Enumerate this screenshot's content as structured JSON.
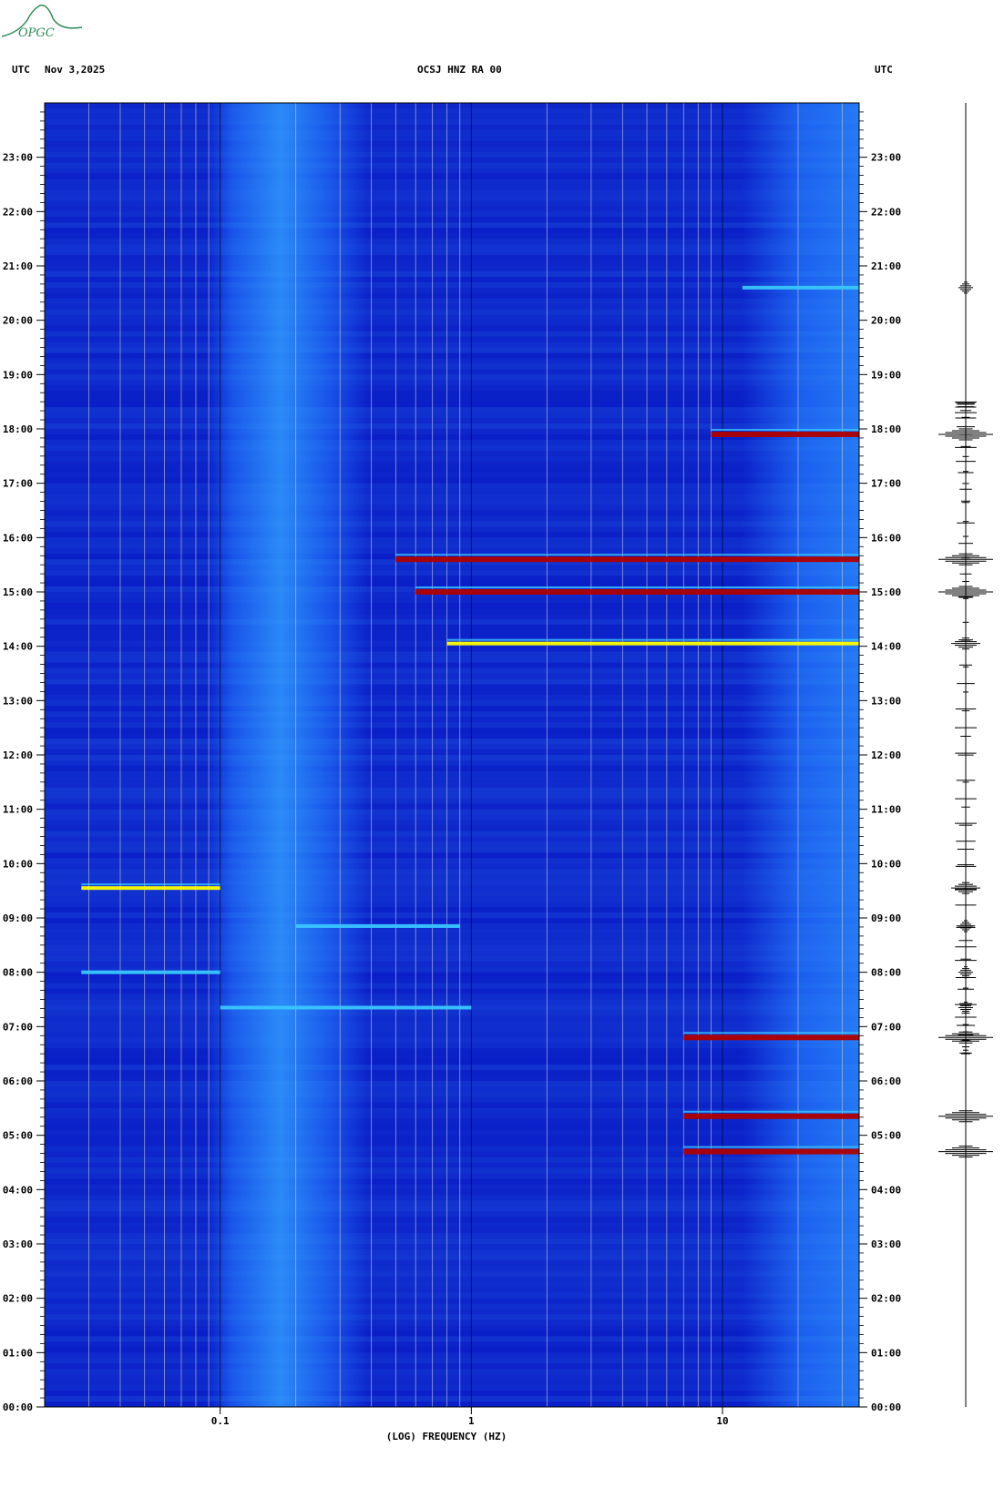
{
  "header": {
    "utc_left": "UTC",
    "date": "Nov 3,2025",
    "station": "OCSJ HNZ RA 00",
    "utc_right": "UTC"
  },
  "logo": {
    "text": "OPGC",
    "icon": "volcano-logo",
    "color": "#2e8b57"
  },
  "chart_data": {
    "type": "heatmap",
    "title": "OCSJ HNZ RA 00",
    "date": "Nov 3,2025",
    "xlabel": "(LOG) FREQUENCY (HZ)",
    "x_scale": "log",
    "xlim": [
      0.02,
      35
    ],
    "x_tick_labels": [
      {
        "value": 0.1,
        "label": "0.1"
      },
      {
        "value": 1,
        "label": "1"
      },
      {
        "value": 10,
        "label": "10"
      }
    ],
    "ylim_hours": [
      0,
      24
    ],
    "y_tick_labels": [
      "00:00",
      "01:00",
      "02:00",
      "03:00",
      "04:00",
      "05:00",
      "06:00",
      "07:00",
      "08:00",
      "09:00",
      "10:00",
      "11:00",
      "12:00",
      "13:00",
      "14:00",
      "15:00",
      "16:00",
      "17:00",
      "18:00",
      "19:00",
      "20:00",
      "21:00",
      "22:00",
      "23:00"
    ],
    "colors": {
      "background": "#0b1fc8",
      "low": "#0b1fc8",
      "mid": "#39c6ff",
      "high": "#ffff00",
      "peak": "#b00000"
    },
    "microseism_band_hz": [
      0.1,
      0.3
    ],
    "events": [
      {
        "time_hours": 4.7,
        "fmin": 7,
        "fmax": 35,
        "level": "peak"
      },
      {
        "time_hours": 5.35,
        "fmin": 7,
        "fmax": 35,
        "level": "peak"
      },
      {
        "time_hours": 7.35,
        "fmin": 0.1,
        "fmax": 1.0,
        "level": "mid"
      },
      {
        "time_hours": 6.8,
        "fmin": 7,
        "fmax": 35,
        "level": "peak"
      },
      {
        "time_hours": 8.0,
        "fmin": 0.028,
        "fmax": 0.1,
        "level": "mid"
      },
      {
        "time_hours": 8.85,
        "fmin": 0.2,
        "fmax": 0.9,
        "level": "mid"
      },
      {
        "time_hours": 9.55,
        "fmin": 0.028,
        "fmax": 0.1,
        "level": "high"
      },
      {
        "time_hours": 14.05,
        "fmin": 0.8,
        "fmax": 35,
        "level": "high"
      },
      {
        "time_hours": 15.0,
        "fmin": 0.6,
        "fmax": 35,
        "level": "peak"
      },
      {
        "time_hours": 15.6,
        "fmin": 0.5,
        "fmax": 35,
        "level": "peak"
      },
      {
        "time_hours": 17.9,
        "fmin": 9,
        "fmax": 35,
        "level": "peak"
      },
      {
        "time_hours": 20.6,
        "fmin": 12,
        "fmax": 35,
        "level": "mid"
      }
    ]
  }
}
